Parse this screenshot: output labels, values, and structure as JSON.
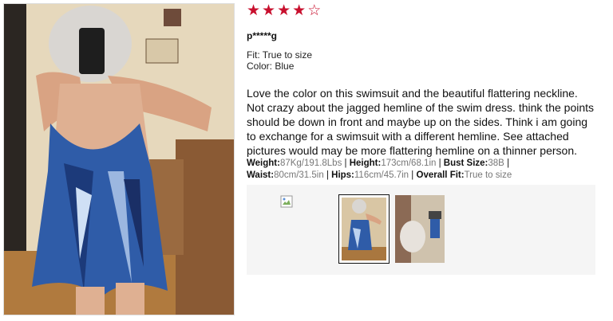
{
  "review": {
    "rating": 4,
    "max_rating": 5,
    "star_color": "#c8102e",
    "reviewer": "p*****g",
    "fit": "Fit: True to size",
    "color": "Color: Blue",
    "text": "Love the color on this swimsuit and the beautiful flattering neckline. Not crazy about the jagged hemline of the swim dress. think the points should be down in front and maybe up on the sides. Think i am going to exchange for a swimsuit with a different hemline. See attached pictures would may be more flattering hemline on a thinner person.",
    "measurements": [
      {
        "label": "Weight:",
        "value": "87Kg/191.8Lbs"
      },
      {
        "label": "Height:",
        "value": "173cm/68.1in"
      },
      {
        "label": "Bust Size:",
        "value": "38B"
      },
      {
        "label": "Waist:",
        "value": "80cm/31.5in"
      },
      {
        "label": "Hips:",
        "value": "116cm/45.7in"
      },
      {
        "label": "Overall Fit:",
        "value": "True to size"
      }
    ]
  },
  "gallery": {
    "thumbnails": [
      "broken-image",
      "photo-selected",
      "photo"
    ]
  },
  "icons": {
    "star": "★",
    "star_empty": "☆"
  }
}
